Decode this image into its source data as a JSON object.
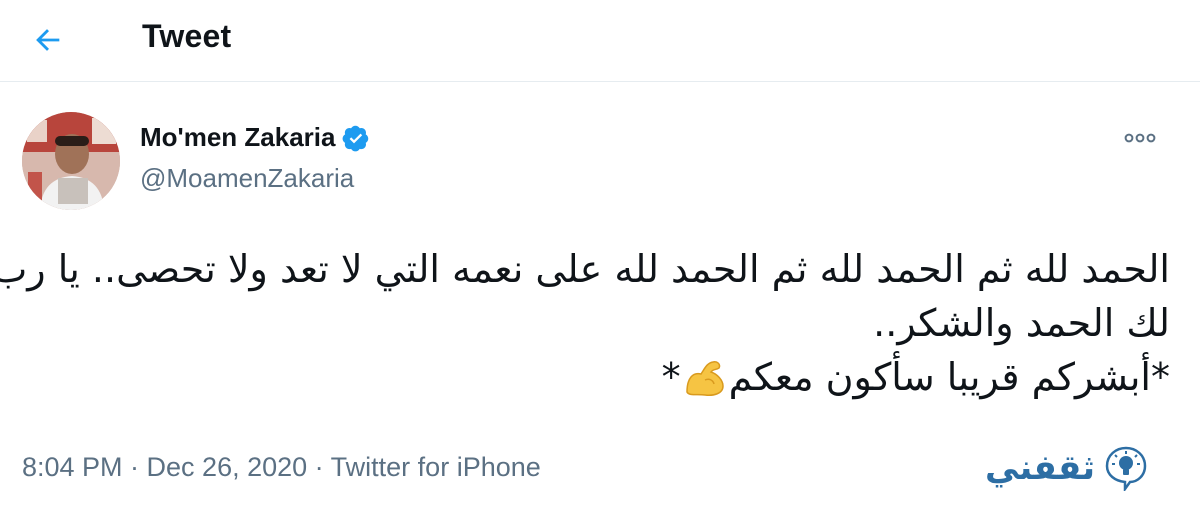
{
  "header": {
    "title": "Tweet",
    "back_icon": "arrow-left-icon"
  },
  "tweet": {
    "author": {
      "display_name": "Mo'men Zakaria",
      "handle": "@MoamenZakaria",
      "verified_icon": "verified-badge-icon"
    },
    "more_icon": "more-horizontal-icon",
    "text_lines": [
      "الحمد لله ثم الحمد لله ثم الحمد لله على نعمه التي لا تعد ولا تحصى.. يا رب",
      "لك الحمد والشكر..",
      "*أبشركم قريبا سأكون معكم",
      "*"
    ],
    "emoji": "flexed-biceps-emoji",
    "timestamp": "8:04 PM · Dec 26, 2020 · Twitter for iPhone"
  },
  "watermark": {
    "text": "ثقفني",
    "icon": "lightbulb-logo-icon"
  },
  "colors": {
    "accent": "#1d9bf0",
    "secondary_text": "#5b7083",
    "watermark": "#2d6ea4"
  }
}
